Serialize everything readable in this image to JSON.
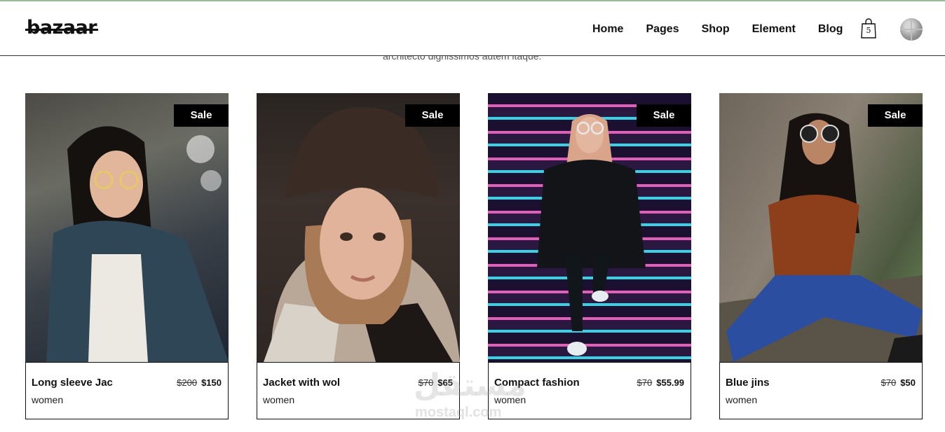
{
  "header": {
    "logo": "bazaar",
    "nav": [
      "Home",
      "Pages",
      "Shop",
      "Element",
      "Blog"
    ],
    "cart_count": "5"
  },
  "intro_text": "architecto dignissimos autem itaque.",
  "products": [
    {
      "badge": "Sale",
      "name": "Long sleeve Jac",
      "category": "women",
      "old_price": "$200",
      "price": "$150"
    },
    {
      "badge": "Sale",
      "name": "Jacket with wol",
      "category": "women",
      "old_price": "$70",
      "price": "$65"
    },
    {
      "badge": "Sale",
      "name": "Compact fashion",
      "category": "women",
      "old_price": "$70",
      "price": "$55.99"
    },
    {
      "badge": "Sale",
      "name": "Blue jins",
      "category": "women",
      "old_price": "$70",
      "price": "$50"
    }
  ],
  "watermark": {
    "line1": "مستقل",
    "line2": "mostaql.com"
  }
}
